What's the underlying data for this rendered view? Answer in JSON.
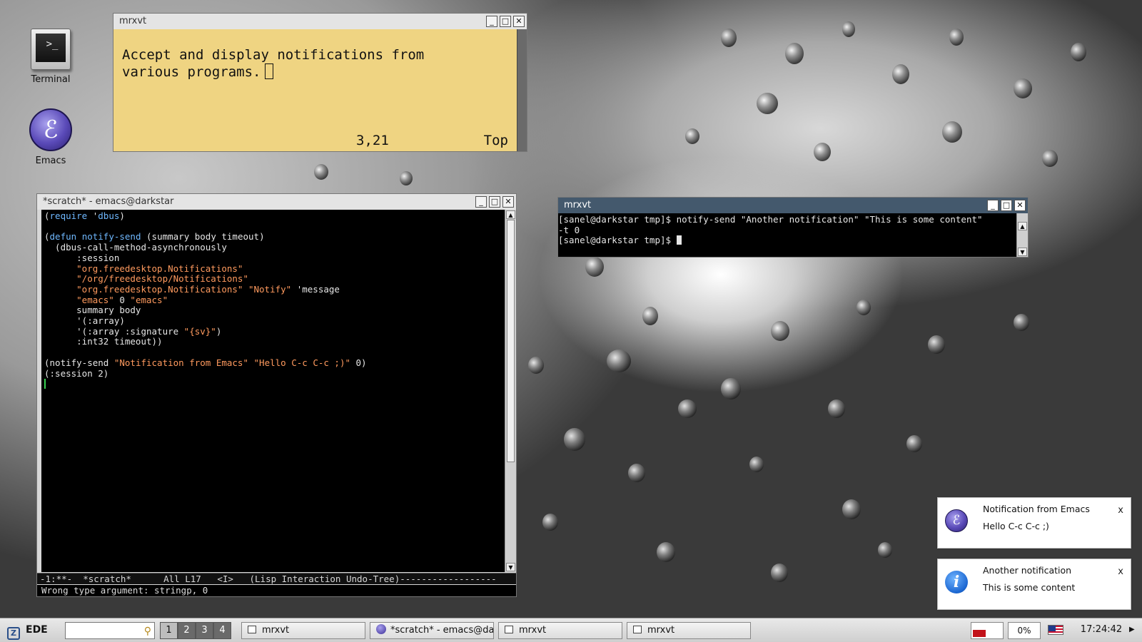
{
  "desktop": {
    "icons": [
      {
        "label": "Terminal",
        "icon": "terminal-icon"
      },
      {
        "label": "Emacs",
        "icon": "emacs-icon"
      }
    ]
  },
  "note_window": {
    "title": "mrxvt",
    "text_line1": "Accept and display notifications from",
    "text_line2": "various programs.",
    "position": "3,21",
    "scroll_state": "Top"
  },
  "emacs_window": {
    "title": "*scratch* - emacs@darkstar",
    "code": {
      "l1a": "(",
      "l1b": "require",
      "l1c": " '",
      "l1d": "dbus",
      "l1e": ")",
      "l3a": "(",
      "l3b": "defun",
      "l3c": " ",
      "l3d": "notify-send",
      "l3e": " (summary body timeout)",
      "l4": "  (dbus-call-method-asynchronously",
      "l5": "      :session",
      "l6s": "\"org.freedesktop.Notifications\"",
      "l7s": "\"/org/freedesktop/Notifications\"",
      "l8s1": "\"org.freedesktop.Notifications\"",
      "l8s2": "\"Notify\"",
      "l8t": " 'message",
      "l9s1": "\"emacs\"",
      "l9t": " 0 ",
      "l9s2": "\"emacs\"",
      "l10": "      summary body",
      "l11": "      '(:array)",
      "l12a": "      '(:array :signature ",
      "l12s": "\"{sv}\"",
      "l12b": ")",
      "l13": "      :int32 timeout))",
      "l15a": "(notify-send ",
      "l15s1": "\"Notification from Emacs\"",
      "l15s2": "\"Hello C-c C-c ;)\"",
      "l15b": " 0)",
      "l16": "(:session 2)"
    },
    "modeline": "-1:**-  *scratch*      All L17   <I>   (Lisp Interaction Undo-Tree)------------------",
    "minibuffer": "Wrong type argument: stringp, 0"
  },
  "terminal_window": {
    "title": "mrxvt",
    "line1": "[sanel@darkstar tmp]$ notify-send \"Another notification\" \"This is some content\"",
    "line2": "-t 0",
    "line3": "[sanel@darkstar tmp]$ "
  },
  "notifications": [
    {
      "title": "Notification from Emacs",
      "body": "Hello C-c C-c ;)",
      "close": "x",
      "icon": "emacs-icon"
    },
    {
      "title": "Another notification",
      "body": "This is some content",
      "close": "x",
      "icon": "info-icon"
    }
  ],
  "taskbar": {
    "start_label": "EDE",
    "pager": [
      "1",
      "2",
      "3",
      "4"
    ],
    "active_desktop": "1",
    "tasks": [
      {
        "label": "mrxvt",
        "icon": "terminal-icon"
      },
      {
        "label": "*scratch* - emacs@darl",
        "icon": "emacs-icon"
      },
      {
        "label": "mrxvt",
        "icon": "terminal-icon"
      },
      {
        "label": "mrxvt",
        "icon": "terminal-icon"
      }
    ],
    "cpu": "0%",
    "clock": "17:24:42"
  },
  "colors": {
    "note_bg": "#efd482",
    "terminal_title": "#44596d",
    "lisp_keyword": "#6fb8ff",
    "lisp_string": "#ff9a5e",
    "cursor_green": "#39d353"
  }
}
